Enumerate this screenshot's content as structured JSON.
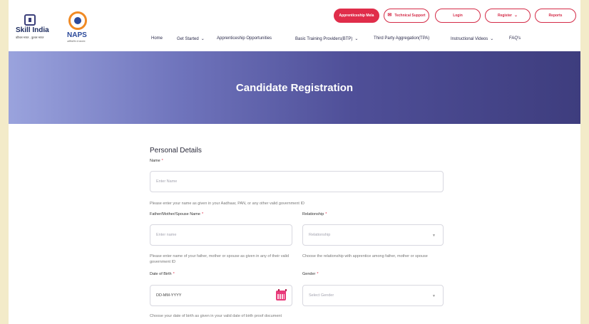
{
  "brand": {
    "skill_india": "Skill India",
    "skill_india_tagline": "कौशल भारत - कुशल भारत",
    "naps": "NAPS",
    "naps_tagline": "अप्रेंटिसशिप से सफलता"
  },
  "top_buttons": {
    "mela": "Apprenticeship Mela",
    "support": "Technical Support",
    "login": "Login",
    "register": "Register",
    "reports": "Reports"
  },
  "nav": [
    "Home",
    "Get Started",
    "Apprenticeship Opportunities",
    "Basic Training Providers(BTP)",
    "Third Party Aggregation(TPA)",
    "Instructional Videos",
    "FAQ's"
  ],
  "banner": {
    "title": "Candidate Registration"
  },
  "form": {
    "section_title": "Personal Details",
    "name": {
      "label": "Name",
      "placeholder": "Enter Name",
      "help": "Please enter your name as given in your Aadhaar, PAN, or any other valid government ID"
    },
    "guardian": {
      "label": "Father/Mother/Spouse Name",
      "placeholder": "Enter name",
      "help": "Please enter name of your father, mother or spouse as given in any of their valid government ID"
    },
    "relationship": {
      "label": "Relationship",
      "placeholder": "Relationship",
      "help": "Choose the relationship with apprentice among father, mother or spouse"
    },
    "dob": {
      "label": "Date of Birth",
      "value": "DD-MM-YYYY",
      "help": "Choose your date of birth as given in your valid date of birth proof document"
    },
    "gender": {
      "label": "Gender",
      "placeholder": "Select Gender"
    },
    "required_mark": "*"
  },
  "colors": {
    "accent": "#e02d4a",
    "banner_start": "#9aa3dd",
    "banner_end": "#3e3d7e"
  }
}
